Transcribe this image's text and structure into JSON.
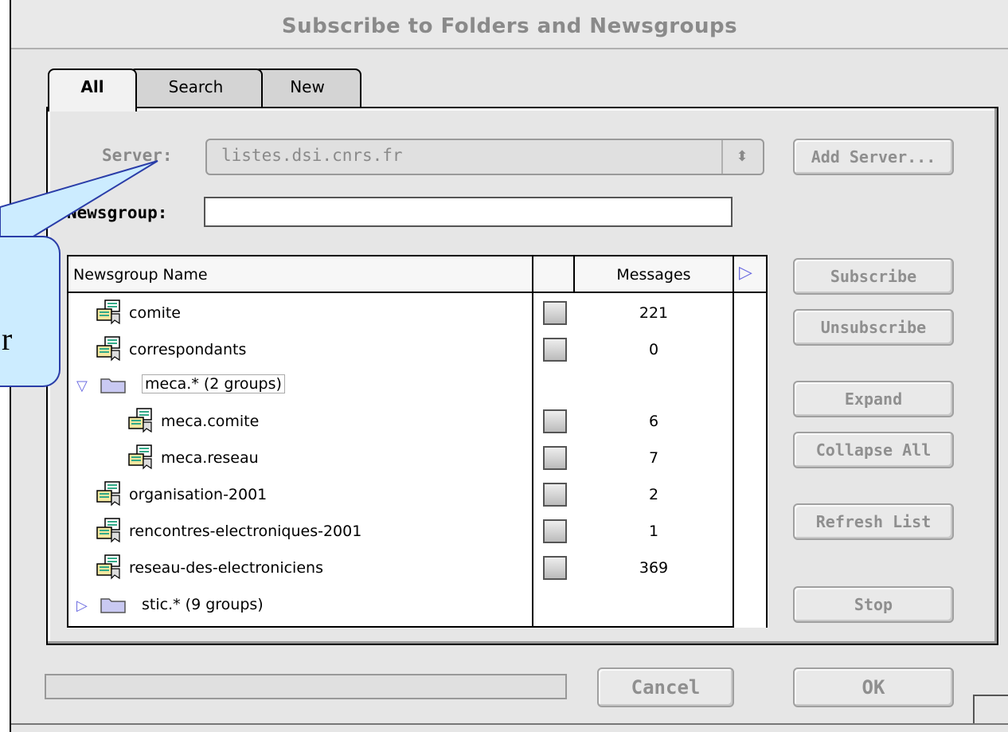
{
  "window": {
    "title": "Subscribe to Folders and Newsgroups"
  },
  "tabs": [
    {
      "label": "All",
      "selected": true
    },
    {
      "label": "Search",
      "selected": false
    },
    {
      "label": "New",
      "selected": false
    }
  ],
  "server": {
    "label": "Server:",
    "value": "listes.dsi.cnrs.fr",
    "add_button": "Add Server..."
  },
  "newsgroup": {
    "label": "Newsgroup:",
    "value": ""
  },
  "list": {
    "columns": {
      "name": "Newsgroup Name",
      "messages": "Messages"
    },
    "rows": [
      {
        "name": "comite",
        "type": "group",
        "indent": 0,
        "messages": "221"
      },
      {
        "name": "correspondants",
        "type": "group",
        "indent": 0,
        "messages": "0"
      },
      {
        "name": "meca.* (2 groups)",
        "type": "folder",
        "expanded": true,
        "indent": 0,
        "messages": ""
      },
      {
        "name": "meca.comite",
        "type": "group",
        "indent": 1,
        "messages": "6"
      },
      {
        "name": "meca.reseau",
        "type": "group",
        "indent": 1,
        "messages": "7"
      },
      {
        "name": "organisation-2001",
        "type": "group",
        "indent": 0,
        "messages": "2"
      },
      {
        "name": "rencontres-electroniques-2001",
        "type": "group",
        "indent": 0,
        "messages": "1"
      },
      {
        "name": "reseau-des-electroniciens",
        "type": "group",
        "indent": 0,
        "messages": "369"
      },
      {
        "name": "stic.* (9 groups)",
        "type": "folder",
        "expanded": false,
        "indent": 0,
        "messages": ""
      }
    ]
  },
  "buttons": {
    "subscribe": "Subscribe",
    "unsubscribe": "Unsubscribe",
    "expand": "Expand",
    "collapse_all": "Collapse All",
    "refresh_list": "Refresh List",
    "stop": "Stop",
    "cancel": "Cancel",
    "ok": "OK"
  },
  "callout": {
    "text": "r"
  },
  "colors": {
    "callout_fill": "#ccecff",
    "callout_border": "#2a3da8",
    "disabled_text": "#8f8f8f"
  }
}
